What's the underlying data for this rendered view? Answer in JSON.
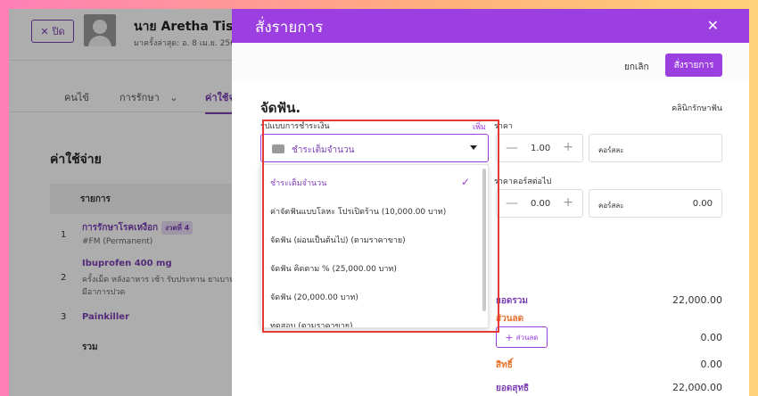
{
  "background": {
    "close_label": "ปิด",
    "patient_name": "นาย Aretha Tissing",
    "visit_info": "มาครั้งล่าสุด: อ. 8 เม.ย. 256",
    "tabs": [
      "คนไข้",
      "การรักษา",
      "ค่าใช้จ่"
    ],
    "section_title": "ค่าใช้จ่าย",
    "table_header": "รายการ",
    "rows": [
      {
        "num": "1",
        "title": "การรักษาโรคเหงือก",
        "badge": "งวดที่ 4",
        "sub": "#FM (Permanent)"
      },
      {
        "num": "2",
        "title": "Ibuprofen 400 mg",
        "sub": "ครั้งเม็ด หลังอาหาร เช้า รับประทาน ยาเบาหวาน",
        "sub2": "มีอาการปวด"
      },
      {
        "num": "3",
        "title": "Painkiller"
      }
    ],
    "total_label": "รวม"
  },
  "modal": {
    "title": "สั่งรายการ",
    "cancel_label": "ยกเลิก",
    "order_label": "สั่งรายการ",
    "procedure_title": "จัดฟัน.",
    "clinic_label": "คลินิกรักษาฟัน",
    "payment": {
      "label": "รูปแบบการชำระเงิน",
      "add_label": "เพิ่ม",
      "selected": "ชำระเต็มจำนวน",
      "options": [
        "ชำระเต็มจำนวน",
        "ค่าจัดฟันแบบโลหะ โปรเปิดร้าน (10,000.00 บาท)",
        "จัดฟัน (ผ่อนเป็นต้นไป) (ตามราคาขาย)",
        "จัดฟัน คิดตาม % (25,000.00 บาท)",
        "จัดฟัน (20,000.00 บาท)",
        "ทดสอบ (ตามราคาขาย)"
      ]
    },
    "price": {
      "label": "ราคา",
      "qty": "1.00",
      "cost_label": "คอร์สละ"
    },
    "next_course": {
      "label": "ราคาคอร์สต่อไป",
      "qty": "0.00",
      "cost_label": "คอร์สละ",
      "cost_value": "0.00"
    },
    "summary": {
      "total_label": "ยอดรวม",
      "total_value": "22,000.00",
      "discount_label": "ส่วนลด",
      "discount_value": "0.00",
      "discount_button": "ส่วนลด",
      "rights_label": "สิทธิ์",
      "rights_value": "0.00",
      "net_label": "ยอดสุทธิ",
      "net_value": "22,000.00"
    }
  },
  "colors": {
    "accent": "#9b3fe0",
    "total": "#7b3fb3",
    "discount": "#e8712b",
    "rights": "#e8712b",
    "highlight": "#e53935"
  },
  "icons": {
    "close": "close-icon",
    "wallet": "wallet-icon",
    "check": "check-icon",
    "chevron": "chevron-down-icon"
  }
}
